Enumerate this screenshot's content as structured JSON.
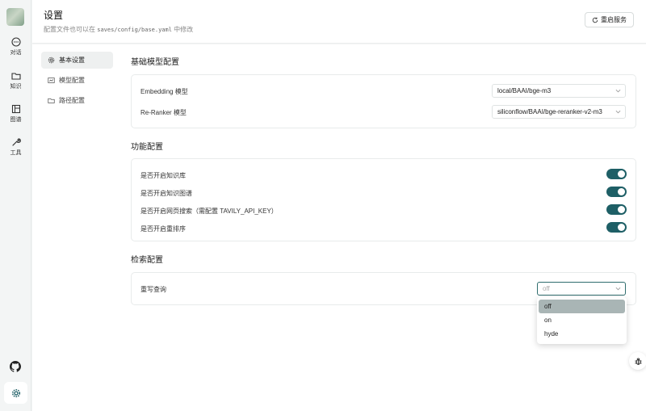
{
  "nav": {
    "items": [
      {
        "label": "对话",
        "icon": "chat-icon"
      },
      {
        "label": "知识",
        "icon": "folder-icon"
      },
      {
        "label": "图谱",
        "icon": "graph-icon"
      },
      {
        "label": "工具",
        "icon": "wrench-icon"
      }
    ],
    "github_icon": "github-icon",
    "settings_icon": "gear-icon"
  },
  "header": {
    "title": "设置",
    "subtitle_prefix": "配置文件也可以在 ",
    "subtitle_path": "saves/config/base.yaml",
    "subtitle_suffix": " 中修改",
    "restart_label": "重启服务"
  },
  "subnav": {
    "items": [
      {
        "label": "基本设置",
        "icon": "gear-icon",
        "active": true
      },
      {
        "label": "模型配置",
        "icon": "model-icon",
        "active": false
      },
      {
        "label": "路径配置",
        "icon": "folder-icon",
        "active": false
      }
    ]
  },
  "sections": {
    "base_model": {
      "title": "基础模型配置",
      "embedding_label": "Embedding 模型",
      "embedding_value": "local/BAAI/bge-m3",
      "reranker_label": "Re-Ranker 模型",
      "reranker_value": "siliconflow/BAAI/bge-reranker-v2-m3"
    },
    "features": {
      "title": "功能配置",
      "toggles": [
        {
          "label": "是否开启知识库",
          "on": true
        },
        {
          "label": "是否开启知识图谱",
          "on": true
        },
        {
          "label": "是否开启网页搜索（需配置 TAVILY_API_KEY）",
          "on": true
        },
        {
          "label": "是否开启重排序",
          "on": true
        }
      ]
    },
    "retrieval": {
      "title": "检索配置",
      "rewrite_label": "重写查询",
      "rewrite_value": "off",
      "options": [
        "off",
        "on",
        "hyde"
      ]
    }
  },
  "colors": {
    "accent": "#1e5f66",
    "selected_option": "#a9b5b5"
  }
}
